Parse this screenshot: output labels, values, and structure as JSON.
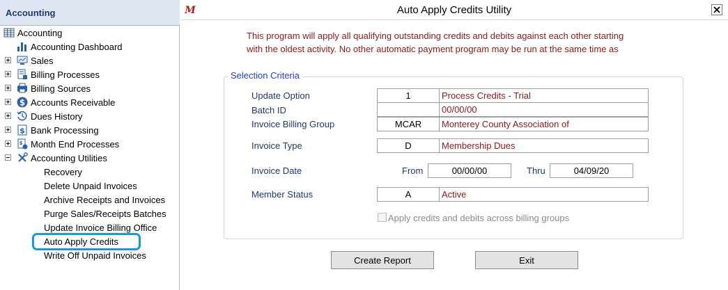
{
  "sidebar": {
    "header": "Accounting",
    "root": "Accounting",
    "items": [
      {
        "label": "Accounting Dashboard"
      },
      {
        "label": "Sales"
      },
      {
        "label": "Billing Processes"
      },
      {
        "label": "Billing Sources"
      },
      {
        "label": "Accounts Receivable"
      },
      {
        "label": "Dues History"
      },
      {
        "label": "Bank Processing"
      },
      {
        "label": "Month End Processes"
      },
      {
        "label": "Accounting Utilities"
      }
    ],
    "utilities": [
      {
        "label": "Recovery"
      },
      {
        "label": "Delete Unpaid Invoices"
      },
      {
        "label": "Archive Receipts and Invoices"
      },
      {
        "label": "Purge Sales/Receipts Batches"
      },
      {
        "label": "Update Invoice Billing Office"
      },
      {
        "label": "Auto Apply Credits"
      },
      {
        "label": "Write Off Unpaid Invoices"
      }
    ],
    "highlight_color": "#1a9ad6"
  },
  "dialog": {
    "title": "Auto Apply Credits Utility",
    "note_line1": "This program will apply all qualifying outstanding credits and debits against each other starting",
    "note_line2": "with the oldest activity.  No other automatic payment program may be run at the same time as",
    "group_title": "Selection Criteria",
    "fields": {
      "update_option": {
        "label": "Update Option",
        "code": "1",
        "desc": "Process Credits - Trial"
      },
      "batch_id": {
        "label": "Batch ID",
        "code": "",
        "desc": "00/00/00"
      },
      "billing_group": {
        "label": "Invoice Billing Group",
        "code": "MCAR",
        "desc": "Monterey County Association of"
      },
      "invoice_type": {
        "label": "Invoice Type",
        "code": "D",
        "desc": "Membership Dues"
      },
      "invoice_date": {
        "label": "Invoice Date",
        "from_label": "From",
        "from": "00/00/00",
        "thru_label": "Thru",
        "thru": "04/09/20"
      },
      "member_status": {
        "label": "Member Status",
        "code": "A",
        "desc": "Active"
      }
    },
    "apply_across_label": "Apply credits and debits across billing groups",
    "create_report_label": "Create Report",
    "exit_label": "Exit"
  }
}
